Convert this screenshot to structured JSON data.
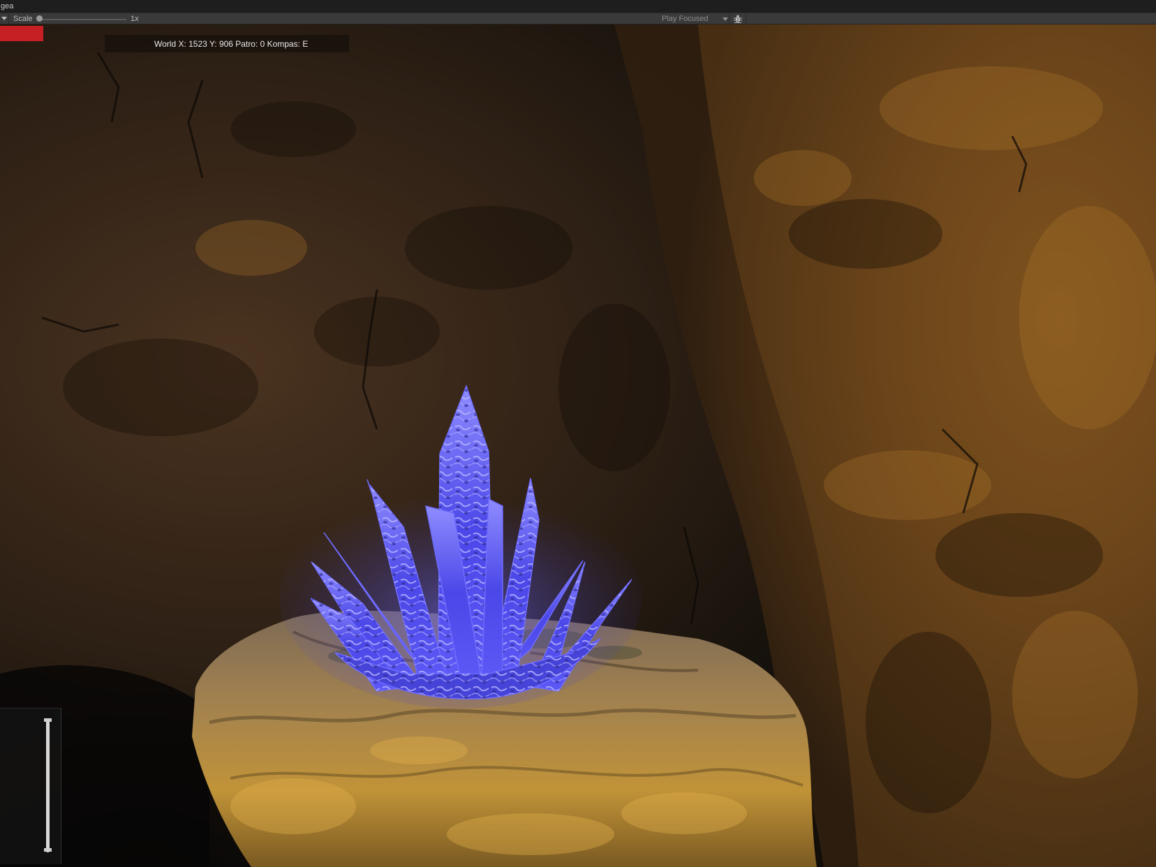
{
  "window": {
    "title": "gea"
  },
  "toolbar": {
    "scale_label": "Scale",
    "scale_value_label": "1x",
    "scale_value": 1,
    "play_mode": "Play Focused",
    "bug_icon": "bug-icon",
    "menu_icon": "chevron-down-icon"
  },
  "hud": {
    "status_text": "World X: 1523 Y: 906 Patro: 0 Kompas: E",
    "indicator_color": "#c62025"
  },
  "side_slider": {
    "value": 1.0
  },
  "scene": {
    "wall_color": "#5a3a18",
    "crystal_color": "#4f4cf0",
    "rock_color": "#b88a3c"
  }
}
